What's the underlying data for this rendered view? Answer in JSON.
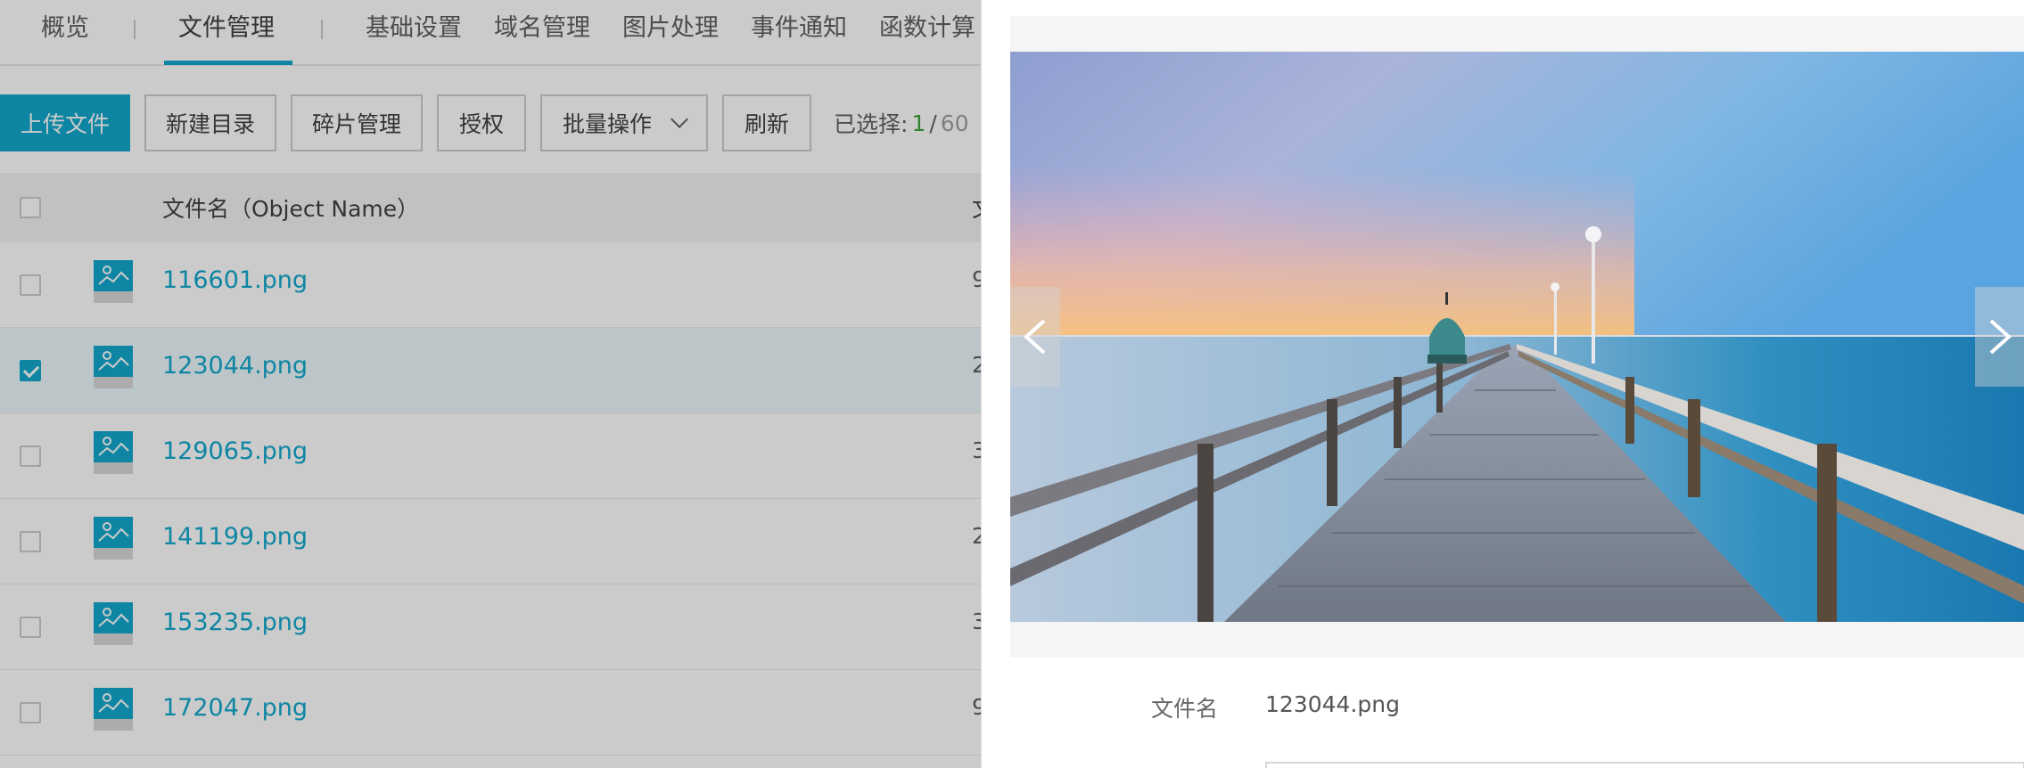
{
  "tabs": [
    {
      "label": "概览",
      "active": false
    },
    {
      "label": "文件管理",
      "active": true
    },
    {
      "label": "基础设置",
      "active": false
    },
    {
      "label": "域名管理",
      "active": false
    },
    {
      "label": "图片处理",
      "active": false
    },
    {
      "label": "事件通知",
      "active": false
    },
    {
      "label": "函数计算",
      "active": false
    }
  ],
  "toolbar": {
    "upload": "上传文件",
    "new_dir": "新建目录",
    "fragments": "碎片管理",
    "authorize": "授权",
    "batch": "批量操作",
    "refresh": "刷新",
    "selected_label": "已选择:",
    "selected_count": "1",
    "selected_sep": "/",
    "selected_total": "60"
  },
  "table": {
    "col_name": "文件名（Object Name）",
    "col_next": "文",
    "rows": [
      {
        "name": "116601.png",
        "size": "9",
        "checked": false
      },
      {
        "name": "123044.png",
        "size": "2",
        "checked": true
      },
      {
        "name": "129065.png",
        "size": "3",
        "checked": false
      },
      {
        "name": "141199.png",
        "size": "2",
        "checked": false
      },
      {
        "name": "153235.png",
        "size": "3",
        "checked": false
      },
      {
        "name": "172047.png",
        "size": "9",
        "checked": false
      }
    ]
  },
  "preview": {
    "filename_label": "文件名",
    "filename_value": "123044.png"
  },
  "colors": {
    "accent": "#00a2ca",
    "selected_count": "#2e9d2e"
  }
}
